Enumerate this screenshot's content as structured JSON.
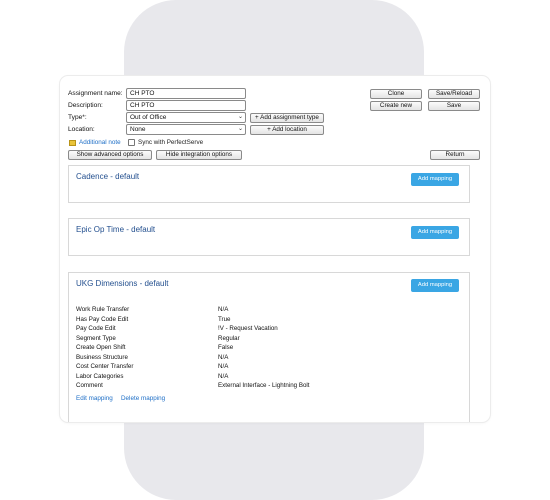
{
  "form": {
    "assignment_name_label": "Assignment name:",
    "assignment_name_value": "CH PTO",
    "description_label": "Description:",
    "description_value": "CH PTO",
    "type_label": "Type*:",
    "type_value": "Out of Office",
    "location_label": "Location:",
    "location_value": "None",
    "add_assignment_type": "+ Add assignment type",
    "add_location": "+ Add location",
    "additional_note": "Additional note",
    "sync_label": "Sync with PerfectServe",
    "sync_checked": false,
    "show_advanced": "Show advanced options",
    "hide_integration": "Hide integration options"
  },
  "actions": {
    "clone": "Clone",
    "save_reload": "Save/Reload",
    "create_new": "Create new",
    "save": "Save",
    "return": "Return"
  },
  "panels": [
    {
      "title": "Cadence - default",
      "add_mapping": "Add mapping"
    },
    {
      "title": "Epic Op Time - default",
      "add_mapping": "Add mapping"
    },
    {
      "title": "UKG Dimensions - default",
      "add_mapping": "Add mapping",
      "rows": [
        {
          "key": "Work Rule Transfer",
          "value": "N/A"
        },
        {
          "key": "Has Pay Code Edit",
          "value": "True"
        },
        {
          "key": "Pay Code Edit",
          "value": "!V - Request Vacation"
        },
        {
          "key": "Segment Type",
          "value": "Regular"
        },
        {
          "key": "Create Open Shift",
          "value": "False"
        },
        {
          "key": "Business Structure",
          "value": "N/A"
        },
        {
          "key": "Cost Center Transfer",
          "value": "N/A"
        },
        {
          "key": "Labor Categories",
          "value": "N/A"
        },
        {
          "key": "Comment",
          "value": "External Interface - Lightning Bolt"
        }
      ],
      "edit_mapping": "Edit mapping",
      "delete_mapping": "Delete mapping"
    }
  ],
  "icons": {
    "chevron": "chevron-down-icon",
    "note": "note-icon"
  },
  "colors": {
    "accent_button": "#3aa6e4",
    "panel_title": "#24508f",
    "link": "#1e6fc7",
    "background_pill": "#e8e8ec"
  }
}
